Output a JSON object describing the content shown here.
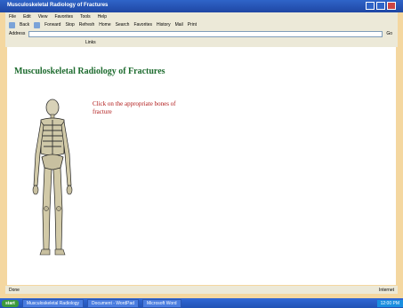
{
  "window": {
    "title": "Musculoskeletal Radiology of Fractures"
  },
  "menu": {
    "items": [
      "File",
      "Edit",
      "View",
      "Favorites",
      "Tools",
      "Help"
    ]
  },
  "toolbar": {
    "items": [
      "Back",
      "Forward",
      "Stop",
      "Refresh",
      "Home",
      "Search",
      "Favorites",
      "History",
      "Mail",
      "Print"
    ]
  },
  "address": {
    "label": "Address",
    "value": "",
    "go_label": "Go"
  },
  "links": {
    "items": [
      "Links"
    ]
  },
  "page": {
    "title": "Musculoskeletal Radiology of Fractures",
    "links": [
      "Click on the appropriate bones of",
      "fracture"
    ]
  },
  "status": {
    "left": "Done",
    "right": "Internet"
  },
  "taskbar": {
    "start_label": "start",
    "tasks": [
      "Musculoskeletal Radiology",
      "Document - WordPad",
      "Microsoft Word"
    ],
    "tray": "12:00 PM"
  },
  "colors": {
    "title_green": "#1d6b2e",
    "link_red": "#b01818",
    "xp_blue": "#2f64c8"
  }
}
